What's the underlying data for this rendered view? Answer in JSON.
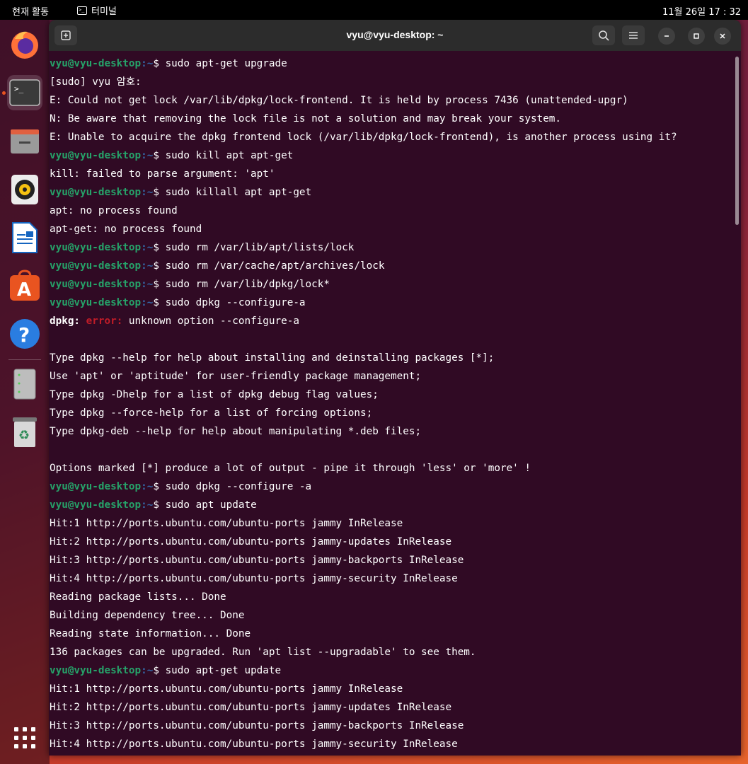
{
  "topbar": {
    "activities": "현재 활동",
    "app_name": "터미널",
    "clock": "11월 26일  17 : 32"
  },
  "dock": {
    "items": [
      "firefox-icon",
      "terminal-icon",
      "files-icon",
      "rhythmbox-icon",
      "libreoffice-writer-icon",
      "app-center-icon",
      "help-icon",
      "disk-icon",
      "trash-icon",
      "show-apps-icon"
    ]
  },
  "window": {
    "title": "vyu@vyu-desktop: ~"
  },
  "terminal": {
    "prompt_user": "vyu@vyu-desktop",
    "prompt_path": ":~",
    "prompt_sign": "$ ",
    "lines": [
      {
        "type": "cmd",
        "text": "sudo apt-get upgrade"
      },
      {
        "type": "out",
        "text": "[sudo] vyu 암호:"
      },
      {
        "type": "out",
        "text": "E: Could not get lock /var/lib/dpkg/lock-frontend. It is held by process 7436 (unattended-upgr)"
      },
      {
        "type": "out",
        "text": "N: Be aware that removing the lock file is not a solution and may break your system."
      },
      {
        "type": "out",
        "text": "E: Unable to acquire the dpkg frontend lock (/var/lib/dpkg/lock-frontend), is another process using it?"
      },
      {
        "type": "cmd",
        "text": "sudo kill apt apt-get"
      },
      {
        "type": "out",
        "text": "kill: failed to parse argument: 'apt'"
      },
      {
        "type": "cmd",
        "text": "sudo killall apt apt-get"
      },
      {
        "type": "out",
        "text": "apt: no process found"
      },
      {
        "type": "out",
        "text": "apt-get: no process found"
      },
      {
        "type": "cmd",
        "text": "sudo rm /var/lib/apt/lists/lock"
      },
      {
        "type": "cmd",
        "text": "sudo rm /var/cache/apt/archives/lock"
      },
      {
        "type": "cmd",
        "text": "sudo rm /var/lib/dpkg/lock*"
      },
      {
        "type": "cmd",
        "text": "sudo dpkg --configure-a"
      },
      {
        "type": "err",
        "prefix": "dpkg: ",
        "errword": "error:",
        "text": " unknown option --configure-a"
      },
      {
        "type": "out",
        "text": ""
      },
      {
        "type": "out",
        "text": "Type dpkg --help for help about installing and deinstalling packages [*];"
      },
      {
        "type": "out",
        "text": "Use 'apt' or 'aptitude' for user-friendly package management;"
      },
      {
        "type": "out",
        "text": "Type dpkg -Dhelp for a list of dpkg debug flag values;"
      },
      {
        "type": "out",
        "text": "Type dpkg --force-help for a list of forcing options;"
      },
      {
        "type": "out",
        "text": "Type dpkg-deb --help for help about manipulating *.deb files;"
      },
      {
        "type": "out",
        "text": ""
      },
      {
        "type": "out",
        "text": "Options marked [*] produce a lot of output - pipe it through 'less' or 'more' !"
      },
      {
        "type": "cmd",
        "text": "sudo dpkg --configure -a"
      },
      {
        "type": "cmd",
        "text": "sudo apt update"
      },
      {
        "type": "out",
        "text": "Hit:1 http://ports.ubuntu.com/ubuntu-ports jammy InRelease"
      },
      {
        "type": "out",
        "text": "Hit:2 http://ports.ubuntu.com/ubuntu-ports jammy-updates InRelease"
      },
      {
        "type": "out",
        "text": "Hit:3 http://ports.ubuntu.com/ubuntu-ports jammy-backports InRelease"
      },
      {
        "type": "out",
        "text": "Hit:4 http://ports.ubuntu.com/ubuntu-ports jammy-security InRelease"
      },
      {
        "type": "out",
        "text": "Reading package lists... Done"
      },
      {
        "type": "out",
        "text": "Building dependency tree... Done"
      },
      {
        "type": "out",
        "text": "Reading state information... Done"
      },
      {
        "type": "out",
        "text": "136 packages can be upgraded. Run 'apt list --upgradable' to see them."
      },
      {
        "type": "cmd",
        "text": "sudo apt-get update"
      },
      {
        "type": "out",
        "text": "Hit:1 http://ports.ubuntu.com/ubuntu-ports jammy InRelease"
      },
      {
        "type": "out",
        "text": "Hit:2 http://ports.ubuntu.com/ubuntu-ports jammy-updates InRelease"
      },
      {
        "type": "out",
        "text": "Hit:3 http://ports.ubuntu.com/ubuntu-ports jammy-backports InRelease"
      },
      {
        "type": "out",
        "text": "Hit:4 http://ports.ubuntu.com/ubuntu-ports jammy-security InRelease"
      }
    ]
  },
  "colors": {
    "terminal_bg": "#300a24",
    "prompt_user": "#26a269",
    "prompt_path": "#12488b",
    "error": "#c01c28",
    "accent": "#e95420"
  }
}
